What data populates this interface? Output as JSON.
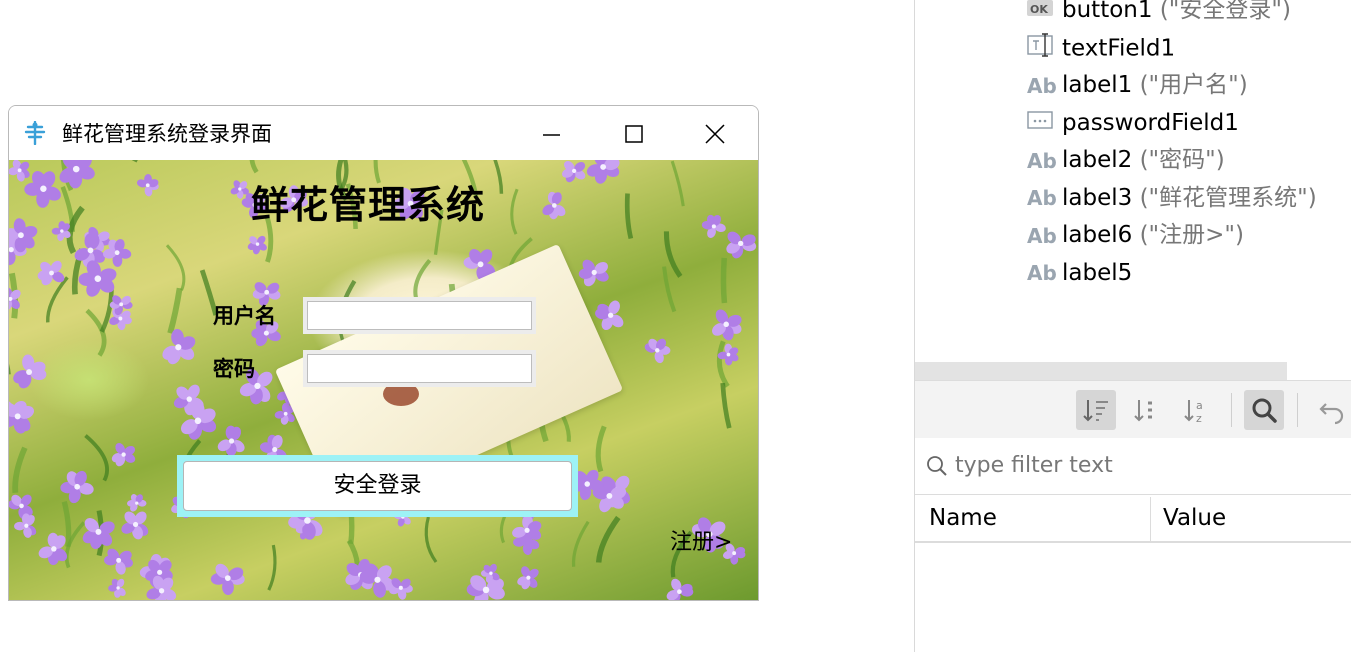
{
  "window": {
    "title": "鲜花管理系统登录界面",
    "app_title": "鲜花管理系统",
    "username_label": "用户名",
    "password_label": "密码",
    "username_value": "",
    "password_value": "",
    "login_button": "安全登录",
    "register_link": "注册>"
  },
  "component_tree": [
    {
      "icon": "ok-button-icon",
      "name": "button1",
      "text": " (\"安全登录\")"
    },
    {
      "icon": "text-field-icon",
      "name": "textField1",
      "text": ""
    },
    {
      "icon": "label-icon",
      "name": "label1",
      "text": " (\"用户名\")"
    },
    {
      "icon": "password-field-icon",
      "name": "passwordField1",
      "text": ""
    },
    {
      "icon": "label-icon",
      "name": "label2",
      "text": " (\"密码\")"
    },
    {
      "icon": "label-icon",
      "name": "label3",
      "text": " (\"鲜花管理系统\")"
    },
    {
      "icon": "label-icon",
      "name": "label6",
      "text": " (\"注册>\")"
    },
    {
      "icon": "label-icon",
      "name": "label5",
      "text": ""
    }
  ],
  "icon_glyphs": {
    "ok": "OK",
    "label": "Ab"
  },
  "properties": {
    "filter_placeholder": "type filter text",
    "columns": [
      "Name",
      "Value"
    ]
  },
  "colors": {
    "login_button_focus": "#9df2f6",
    "flower": "#b07ee6",
    "active_tool": "#d6d6d6"
  }
}
